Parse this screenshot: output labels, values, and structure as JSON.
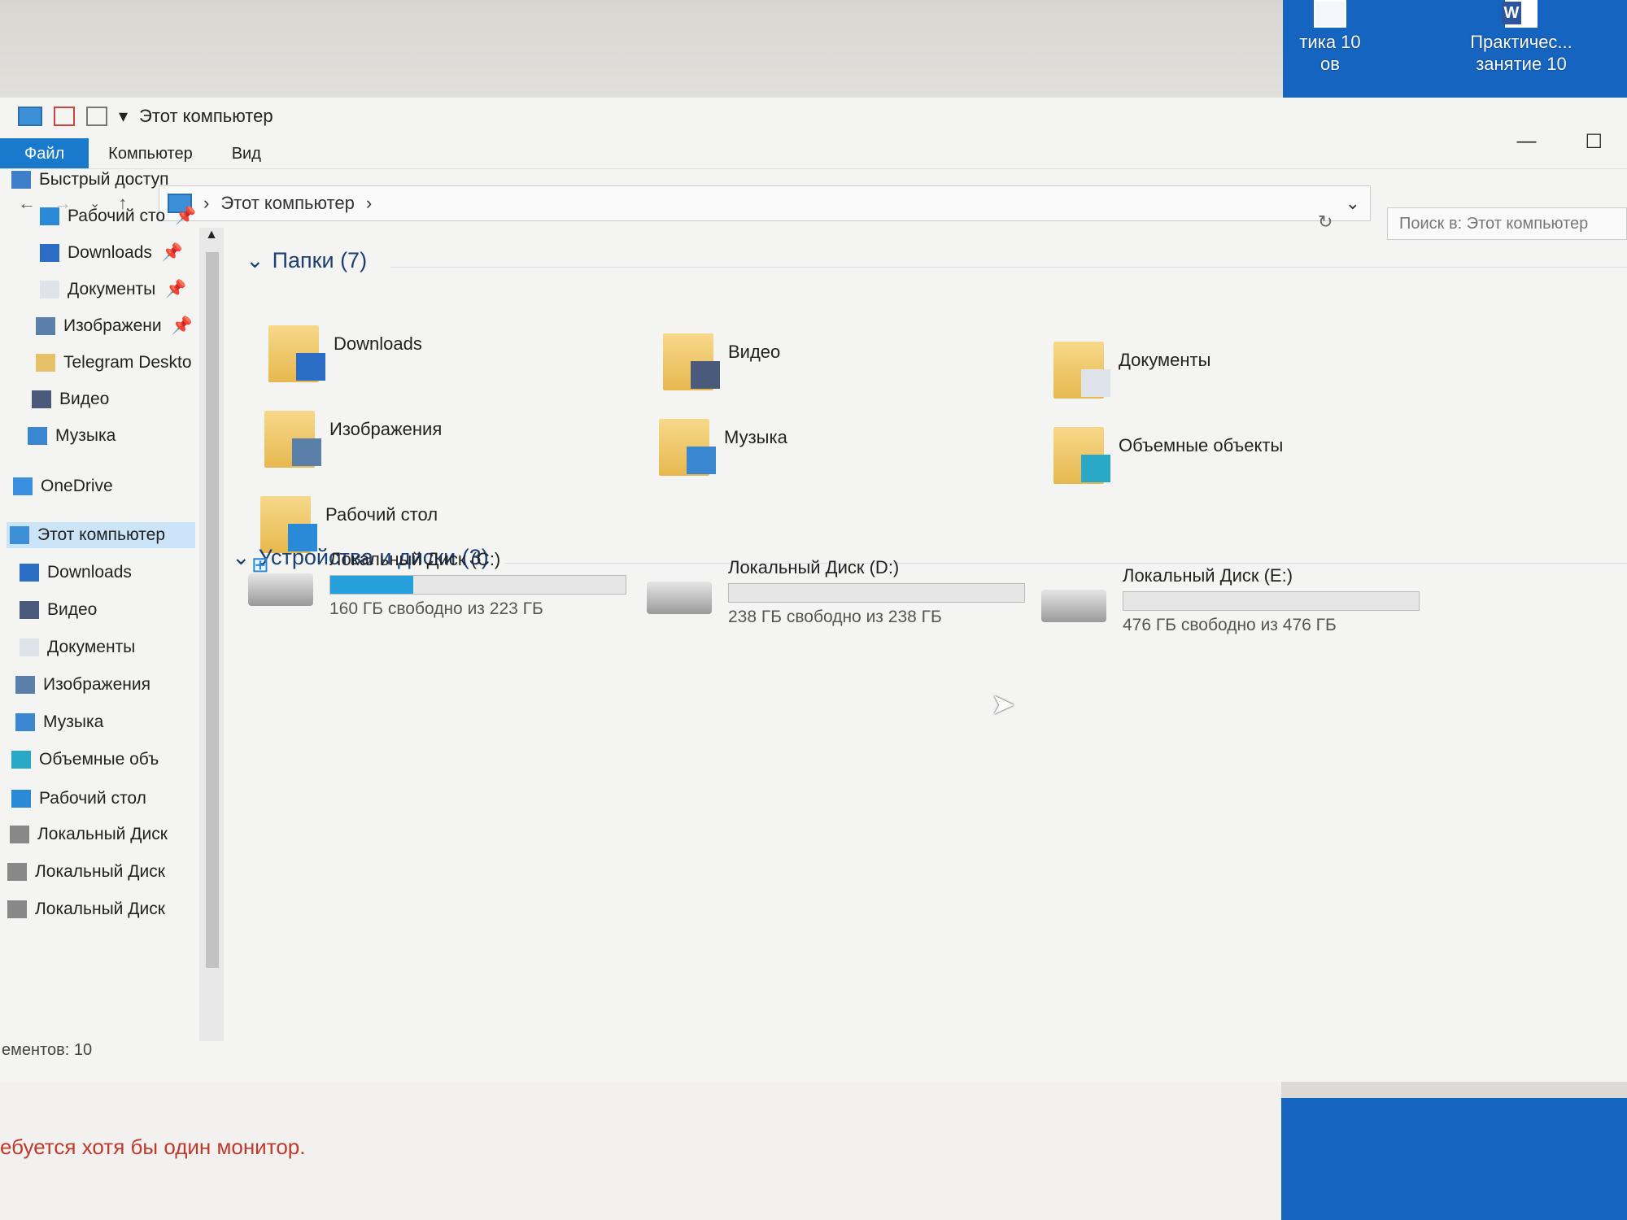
{
  "desktop": {
    "icons": [
      {
        "label": "тика 10\nов",
        "icon": "document-icon"
      },
      {
        "label": "Практичес...\nзанятие 10",
        "icon": "word-document-icon"
      }
    ]
  },
  "window": {
    "title": "Этот компьютер",
    "ribbon_tabs": [
      "Файл",
      "Компьютер",
      "Вид"
    ],
    "address": {
      "crumbs": [
        "Этот компьютер"
      ]
    },
    "search_placeholder": "Поиск в: Этот компьютер",
    "accent": "#1979ca"
  },
  "nav": {
    "items": [
      {
        "label": "Быстрый доступ",
        "icon": "star-icon"
      },
      {
        "label": "Рабочий сто",
        "icon": "desktop-icon",
        "pinned": true
      },
      {
        "label": "Downloads",
        "icon": "download-icon",
        "pinned": true
      },
      {
        "label": "Документы",
        "icon": "documents-icon",
        "pinned": true
      },
      {
        "label": "Изображени",
        "icon": "pictures-icon",
        "pinned": true
      },
      {
        "label": "Telegram Deskto",
        "icon": "folder-icon"
      },
      {
        "label": "Видео",
        "icon": "video-icon"
      },
      {
        "label": "Музыка",
        "icon": "music-icon"
      },
      {
        "label": "OneDrive",
        "icon": "cloud-icon"
      },
      {
        "label": "Этот компьютер",
        "icon": "computer-icon",
        "selected": true
      },
      {
        "label": "Downloads",
        "icon": "download-icon"
      },
      {
        "label": "Видео",
        "icon": "video-icon"
      },
      {
        "label": "Документы",
        "icon": "documents-icon"
      },
      {
        "label": "Изображения",
        "icon": "pictures-icon"
      },
      {
        "label": "Музыка",
        "icon": "music-icon"
      },
      {
        "label": "Объемные объ",
        "icon": "3d-objects-icon"
      },
      {
        "label": "Рабочий стол",
        "icon": "desktop-icon"
      },
      {
        "label": "Локальный Диск",
        "icon": "drive-icon"
      },
      {
        "label": "Локальный Диск",
        "icon": "drive-icon"
      },
      {
        "label": "Локальный Диск",
        "icon": "drive-icon"
      }
    ]
  },
  "folders": {
    "header": "Папки (7)",
    "items": [
      {
        "label": "Downloads",
        "icon": "download-icon"
      },
      {
        "label": "Видео",
        "icon": "video-icon"
      },
      {
        "label": "Документы",
        "icon": "documents-icon"
      },
      {
        "label": "Изображения",
        "icon": "pictures-icon"
      },
      {
        "label": "Музыка",
        "icon": "music-icon"
      },
      {
        "label": "Объемные объекты",
        "icon": "3d-objects-icon"
      },
      {
        "label": "Рабочий стол",
        "icon": "desktop-icon"
      }
    ]
  },
  "devices": {
    "header": "Устройства и диски (3)",
    "items": [
      {
        "label": "Локальный Диск  (C:)",
        "free": "160 ГБ свободно из 223 ГБ",
        "used_fraction": 0.28
      },
      {
        "label": "Локальный Диск (D:)",
        "free": "238 ГБ свободно из 238 ГБ",
        "used_fraction": 0.0
      },
      {
        "label": "Локальный Диск  (E:)",
        "free": "476 ГБ свободно из 476 ГБ",
        "used_fraction": 0.0
      }
    ]
  },
  "status": "ементов: 10",
  "error_text": "ебуется хотя бы один монитор."
}
